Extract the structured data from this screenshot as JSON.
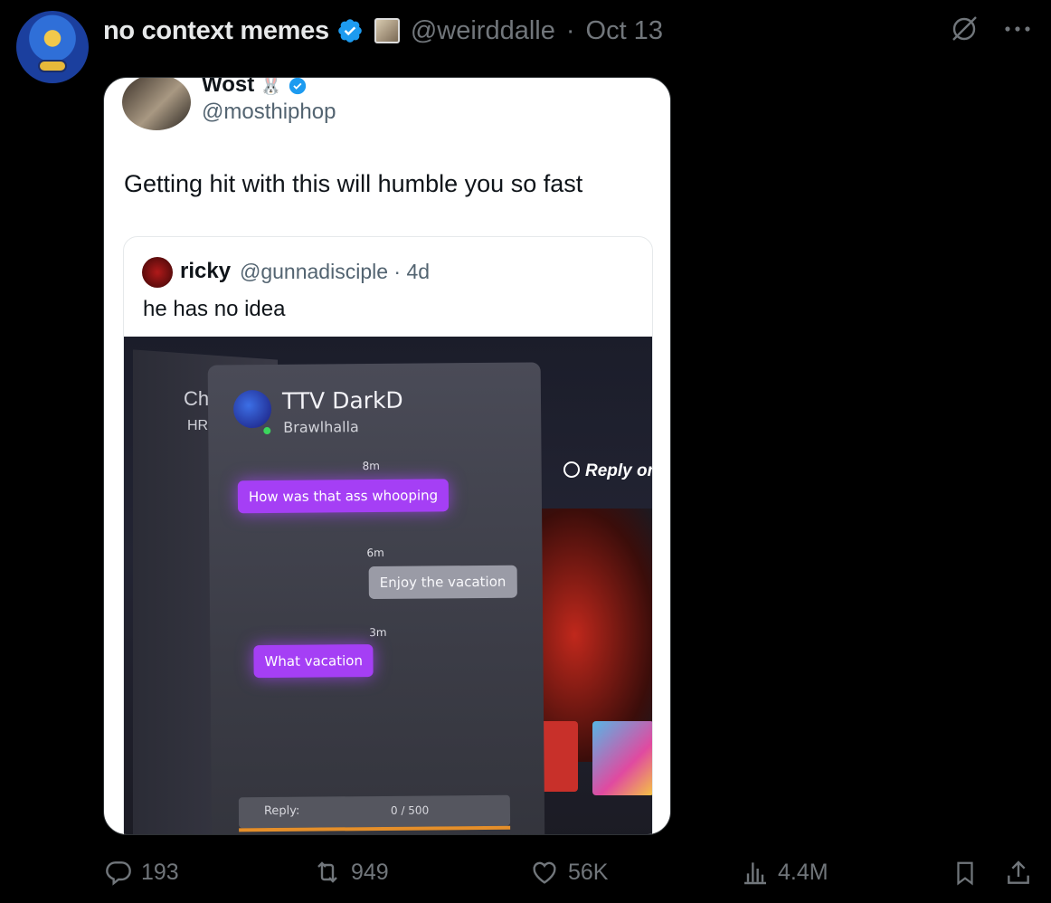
{
  "post": {
    "author_name": "no context memes",
    "author_handle": "@weirddalle",
    "separator": "·",
    "date": "Oct 13"
  },
  "quoted": {
    "name": "Wost",
    "handle": "@mosthiphop",
    "text": "Getting hit with this will humble you so fast",
    "inner": {
      "name": "ricky",
      "handle": "@gunnadisciple",
      "separator": "·",
      "time": "4d",
      "text": "he has no idea"
    },
    "photo": {
      "chat_name": "TTV DarkD",
      "chat_game": "Brawlhalla",
      "side_label_1": "Ch",
      "side_label_2": "HRI",
      "reply_on": "Reply on",
      "messages": [
        {
          "time": "8m",
          "text": "How was that ass whooping"
        },
        {
          "time": "6m",
          "text": "Enjoy the vacation"
        },
        {
          "time": "3m",
          "text": "What vacation"
        }
      ],
      "reply_label": "Reply:",
      "reply_count": "0 / 500"
    }
  },
  "actions": {
    "replies": "193",
    "reposts": "949",
    "likes": "56K",
    "views": "4.4M"
  },
  "colors": {
    "verified": "#1d9bf0",
    "muted": "#71767b",
    "bubble_in": "#a53ff5"
  },
  "icons": [
    "grok-icon",
    "more-icon",
    "reply-icon",
    "repost-icon",
    "like-icon",
    "views-icon",
    "bookmark-icon",
    "share-icon",
    "verified-badge-icon"
  ]
}
